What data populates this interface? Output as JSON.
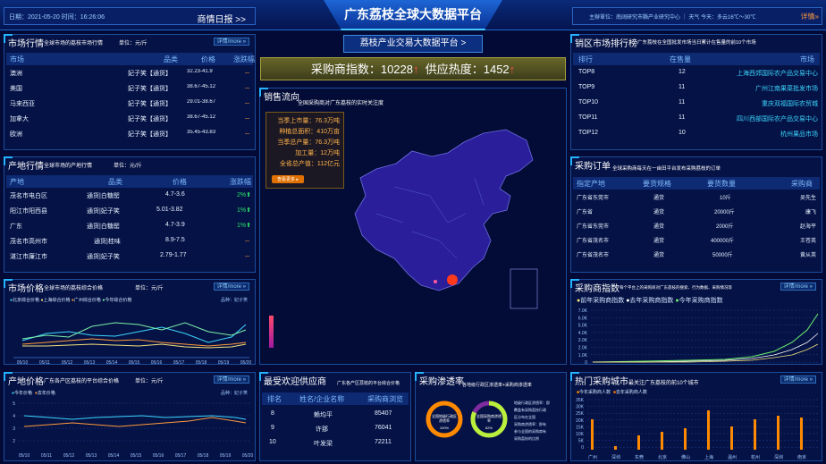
{
  "header": {
    "date_text": "日期：2021-05-20 时间：16:26:06",
    "daily_report": "商情日报 >>",
    "title": "广东荔枝全球大数据平台",
    "subtitle": "荔枝产业交易大数据平台 >",
    "host": "主辦單位：南阔研究市縣产业研究中心 ｜ 天气 今天：多云16℃～30℃",
    "details": "详情»"
  },
  "indices": {
    "text_a": "采购商指数：10228",
    "text_b": "供应热度：1452"
  },
  "market_quotes": {
    "title": "市场行情",
    "subtitle": "全球市场的荔枝市场行情",
    "unit": "单位：元/斤",
    "more": "详情/more »",
    "headers": [
      "市场",
      "品类",
      "价格",
      "涨跌幅"
    ],
    "rows": [
      [
        "澳洲",
        "妃子笑【通货】",
        "32.23-41.9",
        "－"
      ],
      [
        "美国",
        "妃子笑【通货】",
        "38.67-45.12",
        "－"
      ],
      [
        "马来西亚",
        "妃子笑【通货】",
        "29.01-38.67",
        "－"
      ],
      [
        "加拿大",
        "妃子笑【通货】",
        "38.67-45.12",
        "－"
      ],
      [
        "欧洲",
        "妃子笑【通货】",
        "35.45-43.83",
        "－"
      ]
    ]
  },
  "origin_quotes": {
    "title": "产地行情",
    "subtitle": "全球市场的产地行情",
    "unit": "单位：元/斤",
    "headers": [
      "产地",
      "品类",
      "价格",
      "涨跌幅"
    ],
    "rows": [
      [
        "茂名市电白区",
        "通货|白糖罂",
        "4.7-3.6",
        "2%⬆"
      ],
      [
        "阳江市阳西县",
        "通货|妃子笑",
        "5.01-3.82",
        "1%⬆"
      ],
      [
        "广东",
        "通货|白糖罂",
        "4.7-3.9",
        "1%⬆"
      ],
      [
        "茂名市高州市",
        "通货|桂味",
        "8.9-7.5",
        "－"
      ],
      [
        "湛江市廉江市",
        "通货|妃子笑",
        "2.79-1.77",
        "－"
      ]
    ]
  },
  "market_price": {
    "title": "市场价格",
    "subtitle": "全球市场的荔枝综合价格",
    "unit": "单位：元/斤",
    "more": "详情/more »",
    "variety": "品种：妃子笑",
    "legend": [
      "北京综合价格",
      "上海综合价格",
      "广州综合价格",
      "今年综合价格"
    ],
    "dates": [
      "05/10",
      "05/11",
      "05/12",
      "05/13",
      "05/14",
      "05/15",
      "05/16",
      "05/17",
      "05/18",
      "05/19",
      "05/20"
    ]
  },
  "origin_price": {
    "title": "产地价格",
    "subtitle": "广东各产区荔枝的平台综合价格",
    "unit": "单位：元/斤",
    "more": "详情/more »",
    "variety": "品种：妃子笑",
    "legend": [
      "今年价格",
      "去年价格"
    ],
    "dates": [
      "05/10",
      "05/11",
      "05/12",
      "05/13",
      "05/14",
      "05/15",
      "05/16",
      "05/17",
      "05/18",
      "05/19",
      "05/20"
    ],
    "yticks": [
      "5",
      "4",
      "3",
      "2"
    ]
  },
  "sales_flow": {
    "title": "销售流向",
    "subtitle": "全国采购商对广东荔枝的实时关注度",
    "stats": [
      "当季上市量：76.3万吨",
      "种植总面积：410万亩",
      "当季总产量：76.3万吨",
      "加工量：12万吨",
      "全省总产值：112亿元"
    ],
    "button": "查看更多 ▸"
  },
  "supplier": {
    "title": "最受欢迎供应商",
    "subtitle": "广东各产区荔枝的平台综合价格",
    "headers": [
      "排名",
      "姓名/企业名称",
      "采购商浏览"
    ],
    "rows": [
      [
        "8",
        "赖均平",
        "85407"
      ],
      [
        "9",
        "许那",
        "76041"
      ],
      [
        "10",
        "叶发梁",
        "72211"
      ]
    ]
  },
  "penetration": {
    "title": "采购渗透率",
    "subtitle": "各地级行政区渗透率+采购商渗透率",
    "ring1_label": "全国地级行政区渗透率",
    "ring1_value": "100%",
    "ring2_label": "全国采购商渗透率",
    "ring2_value": "82%",
    "notes": [
      "地级行政区渗透率：即",
      "覆盖有采购荔枝行政",
      "区分布在全国",
      "采购商渗透率：即有",
      "参与全国的采购商有",
      "采购荔枝的比例"
    ]
  },
  "rank": {
    "title": "销区市场排行榜",
    "subtitle": "广东荔枝在全国批发市场当日累计在售量的前10个市场",
    "headers": [
      "排行",
      "在售量",
      "市场"
    ],
    "rows": [
      [
        "TOP8",
        "12",
        "上海西郊国际农产品交易中心"
      ],
      [
        "TOP9",
        "11",
        "广州江南果菜批发市场"
      ],
      [
        "TOP10",
        "11",
        "重庆双福国际农贸城"
      ],
      [
        "TOP11",
        "11",
        "四川西部国际农产品交易中心"
      ],
      [
        "TOP12",
        "10",
        "杭州果品市场"
      ]
    ]
  },
  "orders": {
    "title": "采购订单",
    "subtitle": "全球采购商每天在一亩田平台发布采购荔枝的订单",
    "headers": [
      "指定产地",
      "要货规格",
      "要货数量",
      "采购商"
    ],
    "rows": [
      [
        "广东省东莞市",
        "通货",
        "10斤",
        "吴先生"
      ],
      [
        "广东省",
        "通货",
        "20000斤",
        "康飞"
      ],
      [
        "广东省东莞市",
        "通货",
        "2000斤",
        "赵海平"
      ],
      [
        "广东省茂名市",
        "通货",
        "400000斤",
        "王苍英"
      ],
      [
        "广东省茂名市",
        "通货",
        "50000斤",
        "黄从英"
      ]
    ]
  },
  "buyer_index": {
    "title": "采购商指数",
    "subtitle": "每个平台上的采购商对广东荔枝的搜索、行为数据、采购情况等",
    "more": "详情/more »",
    "legend": [
      "前年采购商指数",
      "去年采购商指数",
      "今年采购商指数"
    ],
    "yticks": [
      "7.0K",
      "6.0K",
      "5.0K",
      "4.0K",
      "3.0K",
      "2.0K",
      "1.0K",
      "0"
    ]
  },
  "hot_city": {
    "title": "热门采购城市",
    "subtitle": "最关注广东荔枝的前10个城市",
    "more": "详情/more »",
    "legend": [
      "今年采购商人数",
      "去年采购商人数"
    ],
    "cities": [
      "广州",
      "深圳",
      "东莞",
      "北京",
      "佛山",
      "上海",
      "温州",
      "杭州",
      "深圳",
      "南京"
    ],
    "yticks": [
      "35K",
      "30K",
      "25K",
      "20K",
      "15K",
      "10K",
      "5K",
      "0"
    ]
  },
  "colors": {
    "accent": "#25b4ff",
    "orange": "#ff8a00",
    "green": "#27e36b",
    "panel": "#061448"
  }
}
